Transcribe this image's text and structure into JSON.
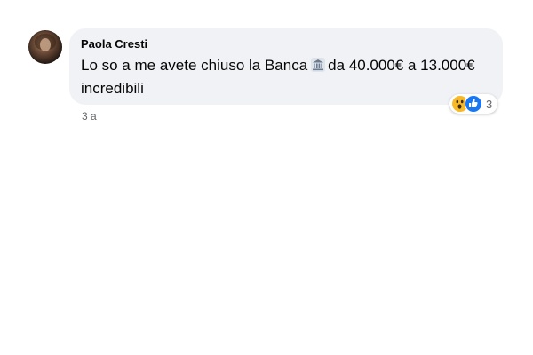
{
  "comment": {
    "author": "Paola Cresti",
    "text_before_icon": "Lo so a me avete chiuso la Banca",
    "inline_icon": "bank-icon",
    "text_after_icon": "da 40.000€ a 13.000€ incredibili",
    "timestamp": "3 a",
    "reactions": {
      "icons": [
        "wow-reaction-icon",
        "like-reaction-icon"
      ],
      "count": "3"
    }
  },
  "colors": {
    "bubble_background": "#f0f2f5",
    "meta_text": "#65676b",
    "like_blue": "#1877f2",
    "wow_yellow": "#f7b928"
  }
}
